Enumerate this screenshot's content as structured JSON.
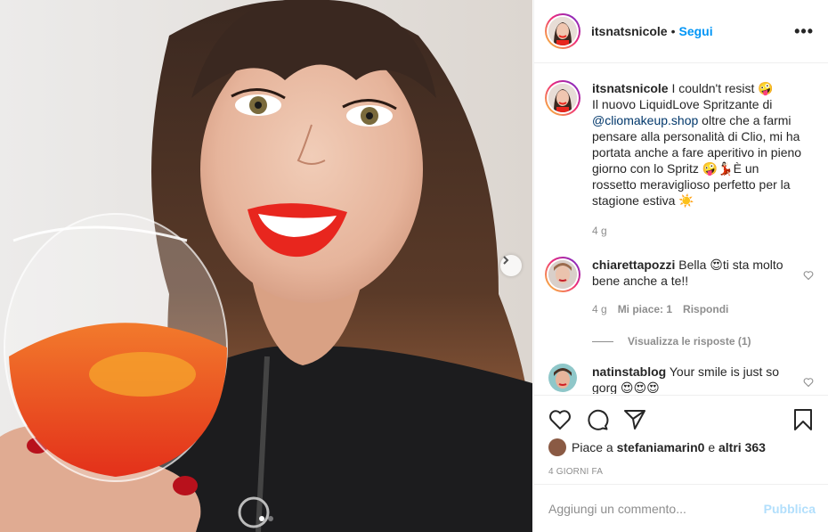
{
  "post": {
    "username": "itsnatsnicole",
    "separator": "•",
    "follow_label": "Segui",
    "more_label": "•••"
  },
  "caption": {
    "username": "itsnatsnicole",
    "text_1": "I couldn't resist 🤪",
    "text_2": "Il nuovo LiquidLove Spritzante di",
    "mention": "@cliomakeup.shop",
    "text_3": "oltre che a farmi pensare alla personalità di Clio, mi ha portata anche a fare aperitivo in pieno giorno con lo Spritz 🤪💃🏻È un rossetto meraviglioso perfetto per la stagione estiva ☀️",
    "age": "4 g"
  },
  "comments": [
    {
      "username": "chiarettapozzi",
      "text": "Bella 😍ti sta molto bene anche a te!!",
      "age": "4 g",
      "likes": "Mi piace: 1",
      "reply_label": "Rispondi",
      "view_replies": "Visualizza le risposte (1)"
    },
    {
      "username": "natinstablog",
      "text": "Your smile is just so gorg 😍😍😍"
    }
  ],
  "likes": {
    "prefix": "Piace a",
    "user": "stefaniamarin0",
    "middle": "e",
    "others": "altri 363"
  },
  "timestamp": "4 giorni fa",
  "add_comment": {
    "placeholder": "Aggiungi un commento...",
    "post_label": "Pubblica"
  },
  "colors": {
    "accent": "#0095f6",
    "lipstick": "#e8261e",
    "spritz": "#f05a1e"
  },
  "carousel": {
    "slides": 2,
    "active": 1
  }
}
